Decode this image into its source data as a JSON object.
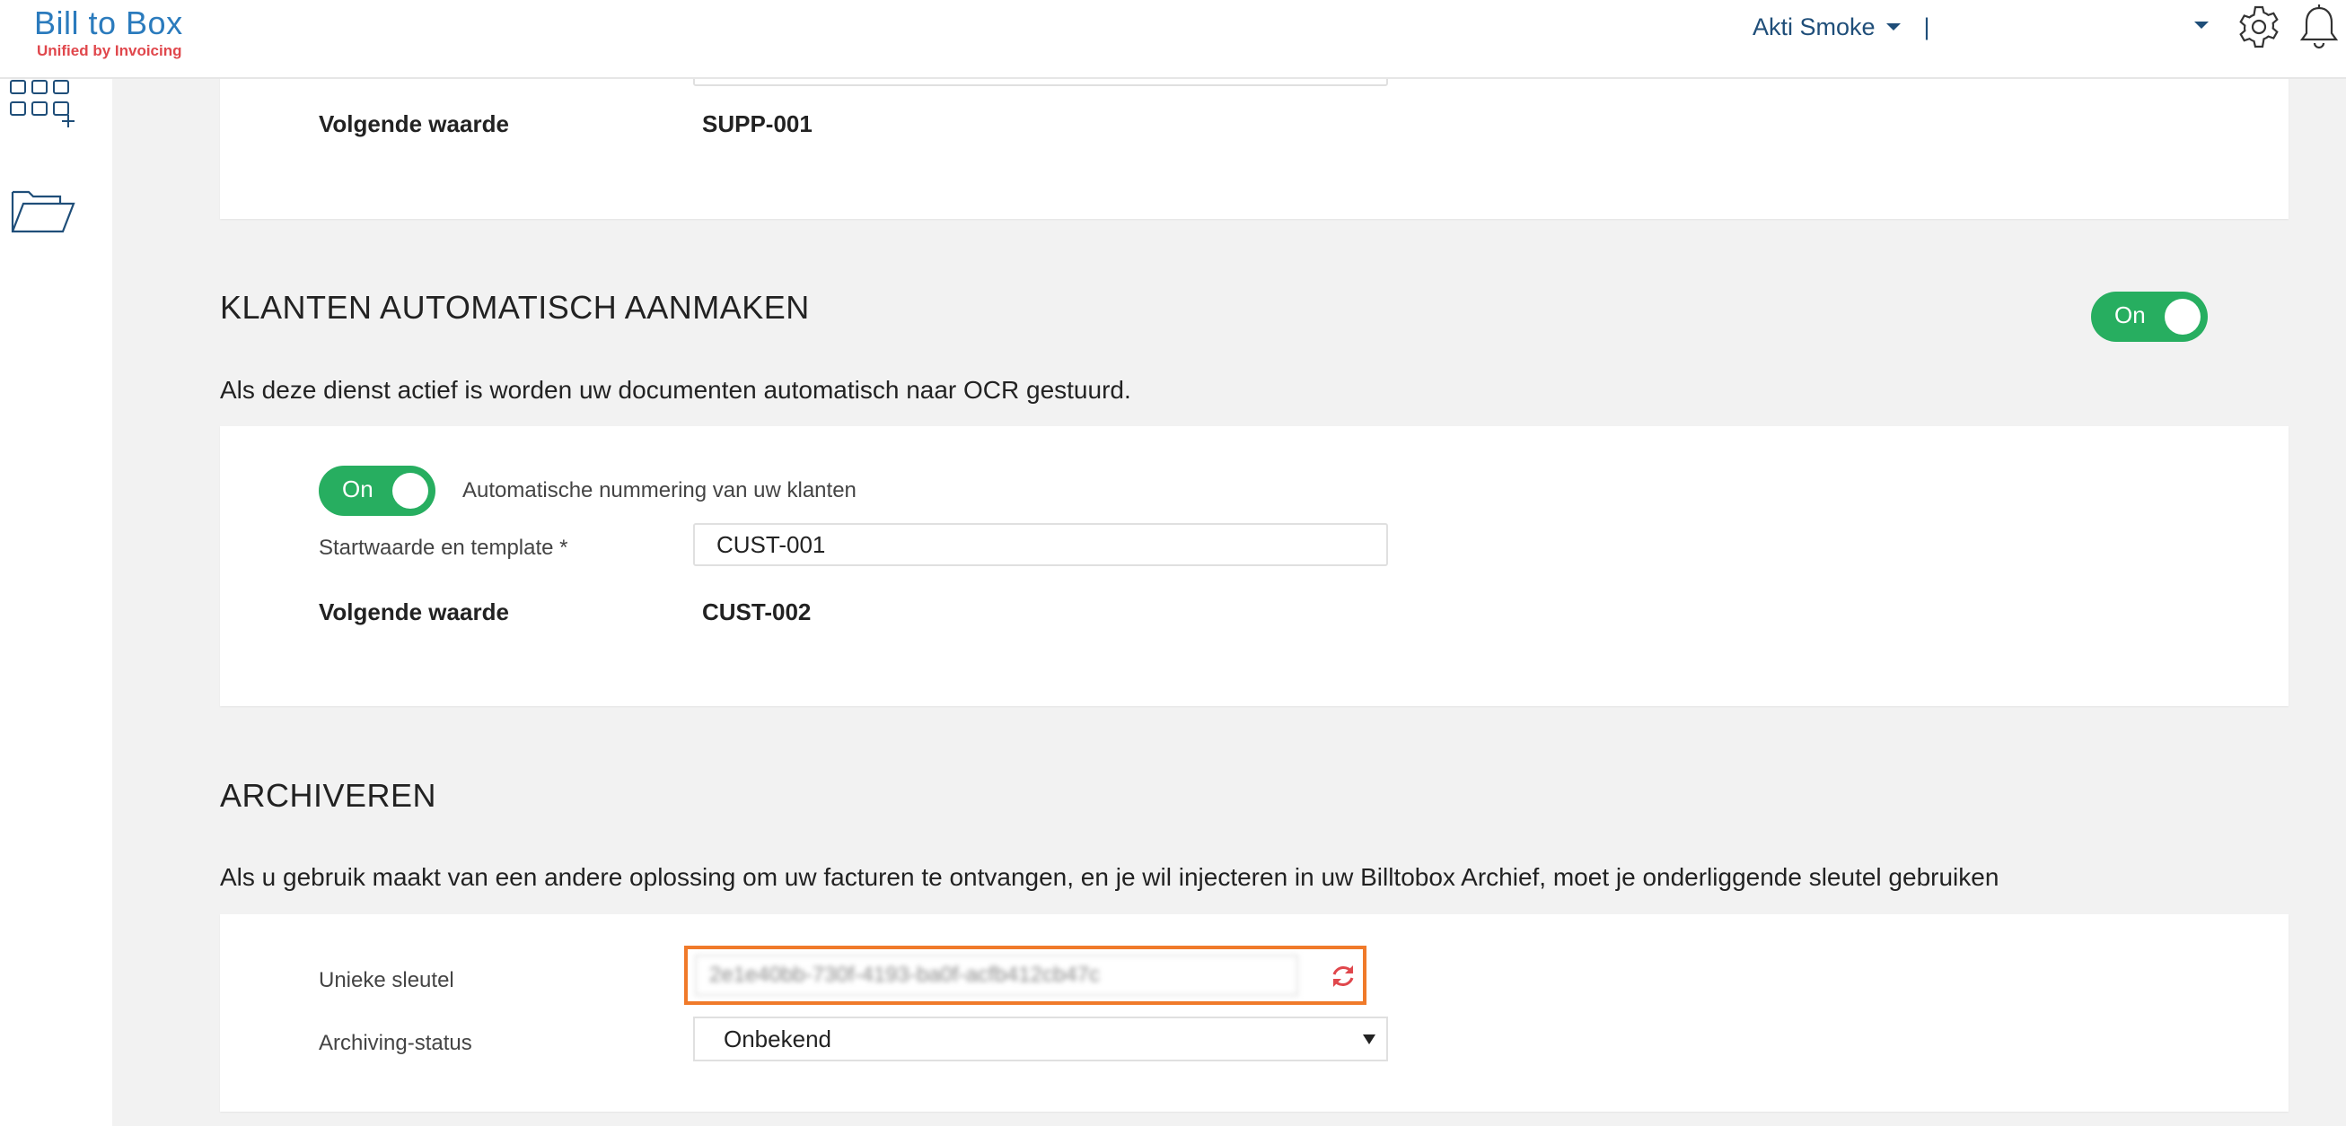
{
  "header": {
    "logo_brand": "Bill to Box",
    "logo_tagline": "Unified by Invoicing",
    "user_name": "Akti Smoke",
    "separator": "|"
  },
  "supplier_section": {
    "next_value_label": "Volgende waarde",
    "next_value": "SUPP-001"
  },
  "customers_section": {
    "title": "KLANTEN AUTOMATISCH AANMAKEN",
    "toggle_label": "On",
    "description": "Als deze dienst actief is worden uw documenten automatisch naar OCR gestuurd.",
    "numbering_toggle_label": "On",
    "numbering_label": "Automatische nummering van uw klanten",
    "start_label": "Startwaarde en template *",
    "start_value": "CUST-001",
    "next_value_label": "Volgende waarde",
    "next_value": "CUST-002"
  },
  "archive_section": {
    "title": "ARCHIVEREN",
    "description": "Als u gebruik maakt van een andere oplossing om uw facturen te ontvangen, en je wil injecteren in uw Billtobox Archief, moet je onderliggende sleutel gebruiken",
    "key_label": "Unieke sleutel",
    "key_value": "2e1e40bb-730f-4193-ba0f-acfb412cb47c",
    "status_label": "Archiving-status",
    "status_value": "Onbekend"
  },
  "colors": {
    "toggle_on": "#27ae60",
    "highlight": "#f07a2a",
    "brand": "#2b7bbd",
    "tagline": "#e0474c",
    "refresh": "#e0474c"
  },
  "icons": [
    "apps-add-icon",
    "folder-icon",
    "gear-icon",
    "bell-icon",
    "refresh-icon",
    "caret-down-icon"
  ]
}
